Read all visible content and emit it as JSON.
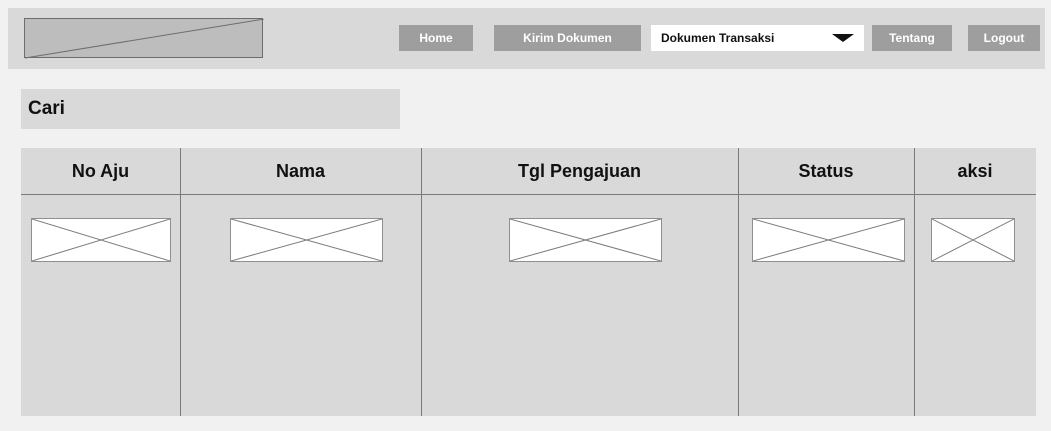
{
  "nav": {
    "home": "Home",
    "kirim_dokumen": "Kirim Dokumen",
    "dokumen_transaksi": "Dokumen Transaksi",
    "tentang": "Tentang",
    "logout": "Logout"
  },
  "search": {
    "label": "Cari"
  },
  "table": {
    "columns": [
      "No Aju",
      "Nama",
      "Tgl Pengajuan",
      "Status",
      "aksi"
    ]
  },
  "colors": {
    "bar_background": "#d9d9d9",
    "nav_button": "#9e9e9e",
    "nav_button_active": "#ffffff",
    "page_background": "#f1f1f1"
  }
}
